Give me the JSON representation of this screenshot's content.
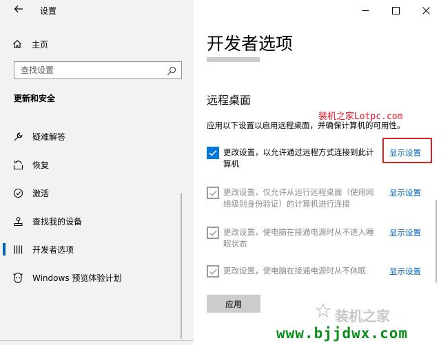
{
  "window": {
    "back_icon": "back-arrow-icon",
    "title": "设置",
    "minimize_icon": "minimize-icon",
    "maximize_icon": "maximize-icon",
    "close_icon": "close-icon"
  },
  "sidebar": {
    "home": {
      "label": "主页",
      "icon": "home-icon"
    },
    "search": {
      "placeholder": "查找设置",
      "icon": "search-icon"
    },
    "section_heading": "更新和安全",
    "items": [
      {
        "label": "疑难解答",
        "icon": "wrench-icon",
        "selected": false
      },
      {
        "label": "恢复",
        "icon": "recovery-icon",
        "selected": false
      },
      {
        "label": "激活",
        "icon": "activation-icon",
        "selected": false
      },
      {
        "label": "查找我的设备",
        "icon": "find-device-icon",
        "selected": false
      },
      {
        "label": "开发者选项",
        "icon": "developer-icon",
        "selected": true
      },
      {
        "label": "Windows 预览体验计划",
        "icon": "insider-icon",
        "selected": false
      }
    ]
  },
  "main": {
    "page_title": "开发者选项",
    "section_title": "远程桌面",
    "watermark_top": "装机之家Lotpc.com",
    "description": "应用以下设置以启用远程桌面，并确保计算机的可用性。",
    "options": [
      {
        "text": "更改设置，以允许通过远程方式连接到此计算机",
        "link": "显示设置",
        "checked": true,
        "enabled": true
      },
      {
        "text": "更改设置，仅允许从运行远程桌面（使用网络级别身份验证）的计算机进行连接",
        "link": "显示设置",
        "checked": true,
        "enabled": false
      },
      {
        "text": "更改设置，使电脑在接通电源时从不进入睡眠状态",
        "link": "显示设置",
        "checked": true,
        "enabled": false
      },
      {
        "text": "更改设置，使电脑在接通电源时从不休眠",
        "link": "显示设置",
        "checked": true,
        "enabled": false
      }
    ],
    "apply_label": "应用",
    "watermark_mid": "装机之家",
    "watermark_bottom": "www.bjjdwx.com"
  },
  "colors": {
    "accent": "#0078d7",
    "link": "#0067c0",
    "highlight": "#e02020",
    "watermark_green": "#0a8f1c"
  }
}
